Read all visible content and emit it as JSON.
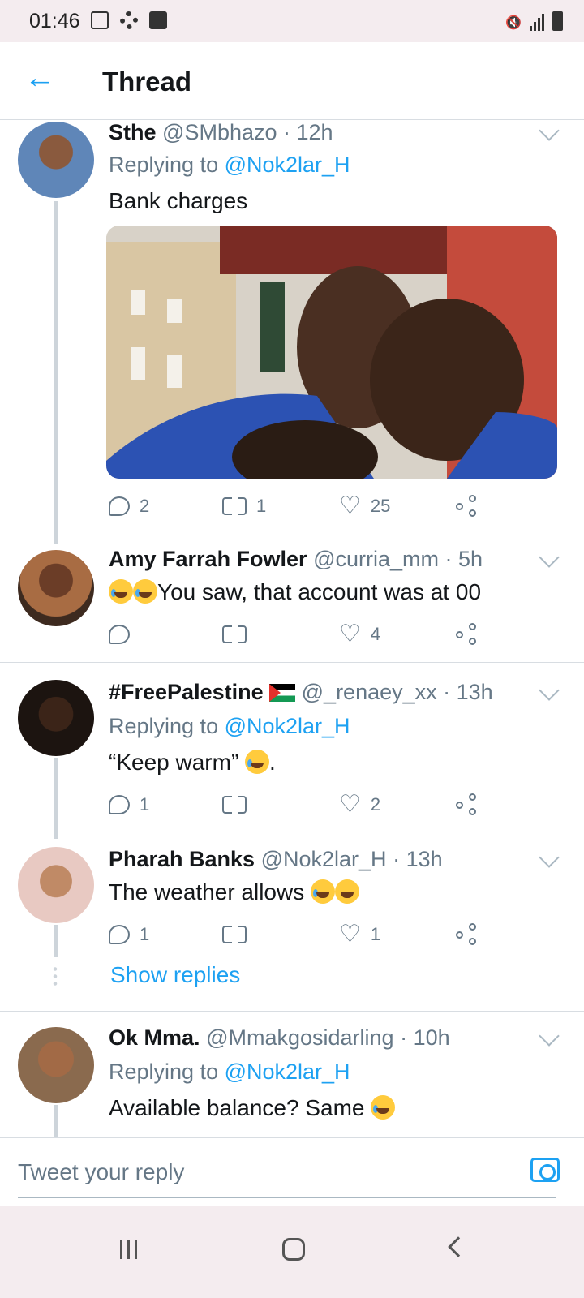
{
  "status_bar": {
    "time": "01:46"
  },
  "header": {
    "title": "Thread",
    "back_icon": "arrow-left-icon"
  },
  "tweets": [
    {
      "name": "Sthe",
      "handle": "@SMbhazo",
      "time": "· 12h",
      "replying_label": "Replying to ",
      "replying_to": "@Nok2lar_H",
      "text": "Bank charges",
      "has_image": true,
      "replies": "2",
      "retweets": "1",
      "likes": "25"
    },
    {
      "name": "Amy Farrah Fowler",
      "handle": "@curria_mm",
      "time": "· 5h",
      "text": "You saw, that account was at 00",
      "replies": "",
      "retweets": "",
      "likes": "4"
    },
    {
      "name": "#FreePalestine",
      "handle": "@_renaey_xx",
      "time": "· 13h",
      "replying_label": "Replying to ",
      "replying_to": "@Nok2lar_H",
      "text": "“Keep warm”",
      "text_suffix": ".",
      "replies": "1",
      "retweets": "",
      "likes": "2"
    },
    {
      "name": "Pharah Banks",
      "handle": "@Nok2lar_H",
      "time": "· 13h",
      "text": "The weather allows",
      "replies": "1",
      "retweets": "",
      "likes": "1"
    },
    {
      "name": "Ok Mma.",
      "handle": "@Mmakgosidarling",
      "time": "· 10h",
      "replying_label": "Replying to ",
      "replying_to": "@Nok2lar_H",
      "text": "Available balance? Same"
    }
  ],
  "show_replies": "Show replies",
  "composer": {
    "placeholder": "Tweet your reply"
  },
  "colors": {
    "accent": "#1da1f2",
    "muted": "#657786",
    "text": "#14171a"
  }
}
